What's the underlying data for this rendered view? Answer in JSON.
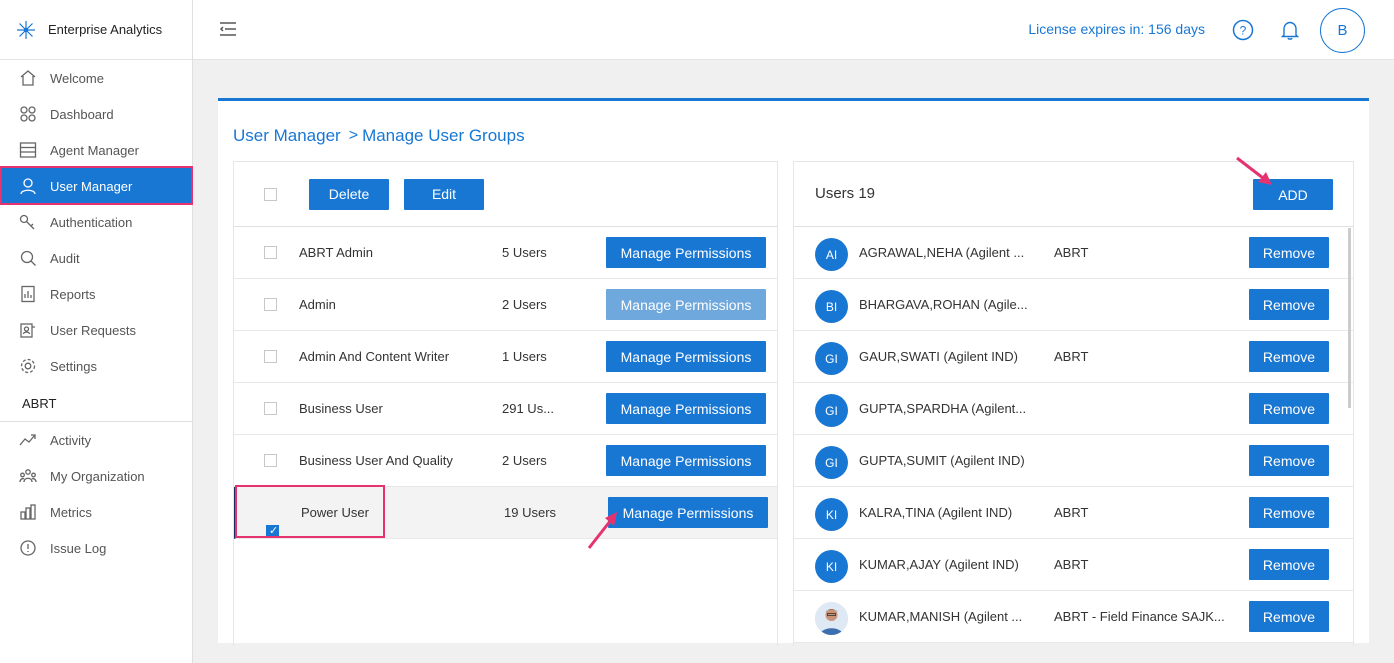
{
  "app": {
    "title": "Enterprise Analytics"
  },
  "sidebar": {
    "items": [
      {
        "label": "Welcome",
        "icon": "home-icon"
      },
      {
        "label": "Dashboard",
        "icon": "grid-icon"
      },
      {
        "label": "Agent Manager",
        "icon": "server-icon"
      },
      {
        "label": "User Manager",
        "icon": "user-icon",
        "active": true
      },
      {
        "label": "Authentication",
        "icon": "key-icon"
      },
      {
        "label": "Audit",
        "icon": "search-icon"
      },
      {
        "label": "Reports",
        "icon": "report-icon"
      },
      {
        "label": "User Requests",
        "icon": "user-request-icon"
      },
      {
        "label": "Settings",
        "icon": "gear-icon"
      }
    ],
    "section_label": "ABRT",
    "section_items": [
      {
        "label": "Activity",
        "icon": "activity-icon"
      },
      {
        "label": "My Organization",
        "icon": "org-icon"
      },
      {
        "label": "Metrics",
        "icon": "metrics-icon"
      },
      {
        "label": "Issue Log",
        "icon": "alert-icon"
      }
    ]
  },
  "topbar": {
    "license": "License expires in: 156 days",
    "avatar_initial": "B"
  },
  "breadcrumb": {
    "root": "User Manager",
    "sep": ">",
    "current": "Manage User Groups"
  },
  "groups": {
    "delete_label": "Delete",
    "edit_label": "Edit",
    "rows": [
      {
        "name": "ABRT Admin",
        "count": "5 Users",
        "button": "Manage Permissions"
      },
      {
        "name": "Admin",
        "count": "2 Users",
        "button": "Manage Permissions"
      },
      {
        "name": "Admin And Content Writer",
        "count": "1 Users",
        "button": "Manage Permissions"
      },
      {
        "name": "Business User",
        "count": "291 Us...",
        "button": "Manage Permissions"
      },
      {
        "name": "Business User And Quality",
        "count": "2 Users",
        "button": "Manage Permissions"
      },
      {
        "name": "Power User",
        "count": "19 Users",
        "button": "Manage Permissions"
      }
    ]
  },
  "users": {
    "title": "Users 19",
    "add_label": "ADD",
    "remove_label": "Remove",
    "rows": [
      {
        "initials": "AI",
        "name": "AGRAWAL,NEHA (Agilent ...",
        "org": "ABRT"
      },
      {
        "initials": "BI",
        "name": "BHARGAVA,ROHAN (Agile...",
        "org": ""
      },
      {
        "initials": "GI",
        "name": "GAUR,SWATI (Agilent IND)",
        "org": "ABRT"
      },
      {
        "initials": "GI",
        "name": "GUPTA,SPARDHA (Agilent...",
        "org": ""
      },
      {
        "initials": "GI",
        "name": "GUPTA,SUMIT (Agilent IND)",
        "org": ""
      },
      {
        "initials": "KI",
        "name": "KALRA,TINA (Agilent IND)",
        "org": "ABRT"
      },
      {
        "initials": "KI",
        "name": "KUMAR,AJAY (Agilent IND)",
        "org": "ABRT"
      },
      {
        "initials": "",
        "name": "KUMAR,MANISH (Agilent ...",
        "org": "ABRT - Field Finance SAJK..."
      }
    ]
  },
  "colors": {
    "accent": "#1977d4",
    "highlight": "#e6336f",
    "muted_button": "#6fa8dc"
  }
}
